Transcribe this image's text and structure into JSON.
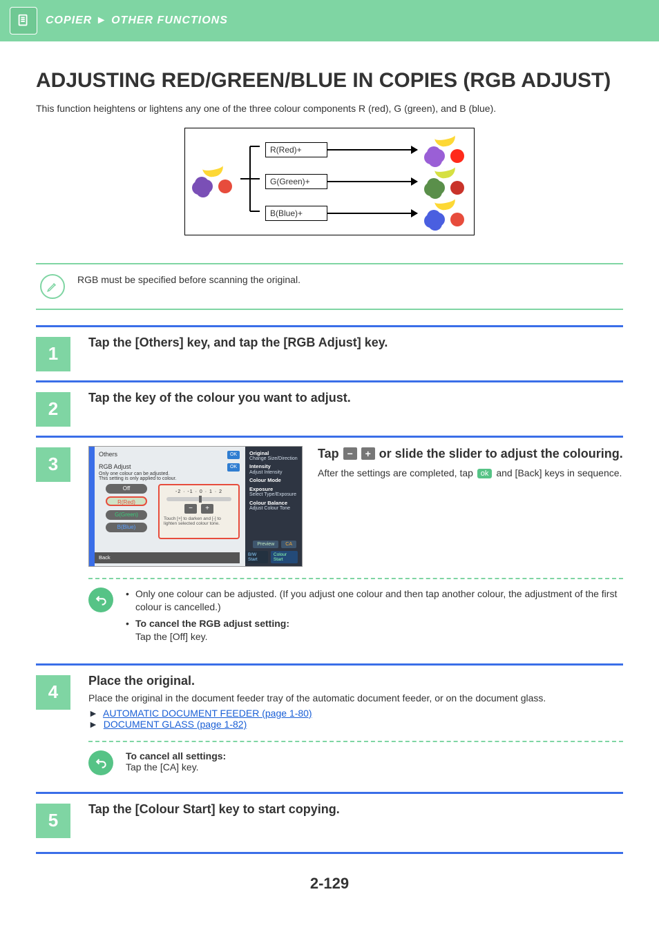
{
  "header": {
    "section": "COPIER",
    "subsection": "OTHER FUNCTIONS"
  },
  "title": "ADJUSTING RED/GREEN/BLUE IN COPIES (RGB ADJUST)",
  "intro": "This function heightens or lightens any one of the three colour components R (red), G (green), and B (blue).",
  "diagram": {
    "labels": [
      "R(Red)+",
      "G(Green)+",
      "B(Blue)+"
    ]
  },
  "note": "RGB must be specified before scanning the original.",
  "steps": {
    "s1": {
      "num": "1",
      "heading": "Tap the [Others] key, and tap the [RGB Adjust] key."
    },
    "s2": {
      "num": "2",
      "heading": "Tap the key of the colour you want to adjust."
    },
    "s3": {
      "num": "3",
      "heading_a": "Tap",
      "heading_b": "or slide the slider to adjust the colouring.",
      "body_a": "After the settings are completed, tap",
      "ok": "ok",
      "body_b": "and [Back] keys in sequence.",
      "screenshot": {
        "others": "Others",
        "panel_title": "RGB Adjust",
        "panel_sub1": "Only one colour can be adjusted.",
        "panel_sub2": "This setting is only applied to colour.",
        "off": "Off",
        "r": "R(Red)",
        "g": "G(Green)",
        "b": "B(Blue)",
        "scale": "-2 · -1 · 0 · 1 · 2",
        "hint": "Touch [+] to darken and [-] to lighten selected colour tone.",
        "ok": "OK",
        "right": {
          "original": "Original",
          "original_sub": "Change Size/Direction",
          "intensity": "Intensity",
          "intensity_sub": "Adjust Intensity",
          "colour_mode": "Colour Mode",
          "exposure": "Exposure",
          "exposure_sub": "Select Type/Exposure",
          "balance": "Colour Balance",
          "balance_sub": "Adjust Colour Tone"
        },
        "preview": "Preview",
        "ca": "CA",
        "bw_start": "B/W Start",
        "colour_start": "Colour Start",
        "back": "Back"
      },
      "tips": {
        "t1": "Only one colour can be adjusted. (If you adjust one colour and then tap another colour, the adjustment of the first colour is cancelled.)",
        "t2_label": "To cancel the RGB adjust setting:",
        "t2_body": "Tap the [Off] key."
      }
    },
    "s4": {
      "num": "4",
      "heading": "Place the original.",
      "body": "Place the original in the document feeder tray of the automatic document feeder, or on the document glass.",
      "link1": "AUTOMATIC DOCUMENT FEEDER (page 1-80)",
      "link2": "DOCUMENT GLASS (page 1-82)",
      "cancel_label": "To cancel all settings:",
      "cancel_body": "Tap the [CA] key."
    },
    "s5": {
      "num": "5",
      "heading": "Tap the [Colour Start] key to start copying."
    }
  },
  "page_number": "2-129"
}
